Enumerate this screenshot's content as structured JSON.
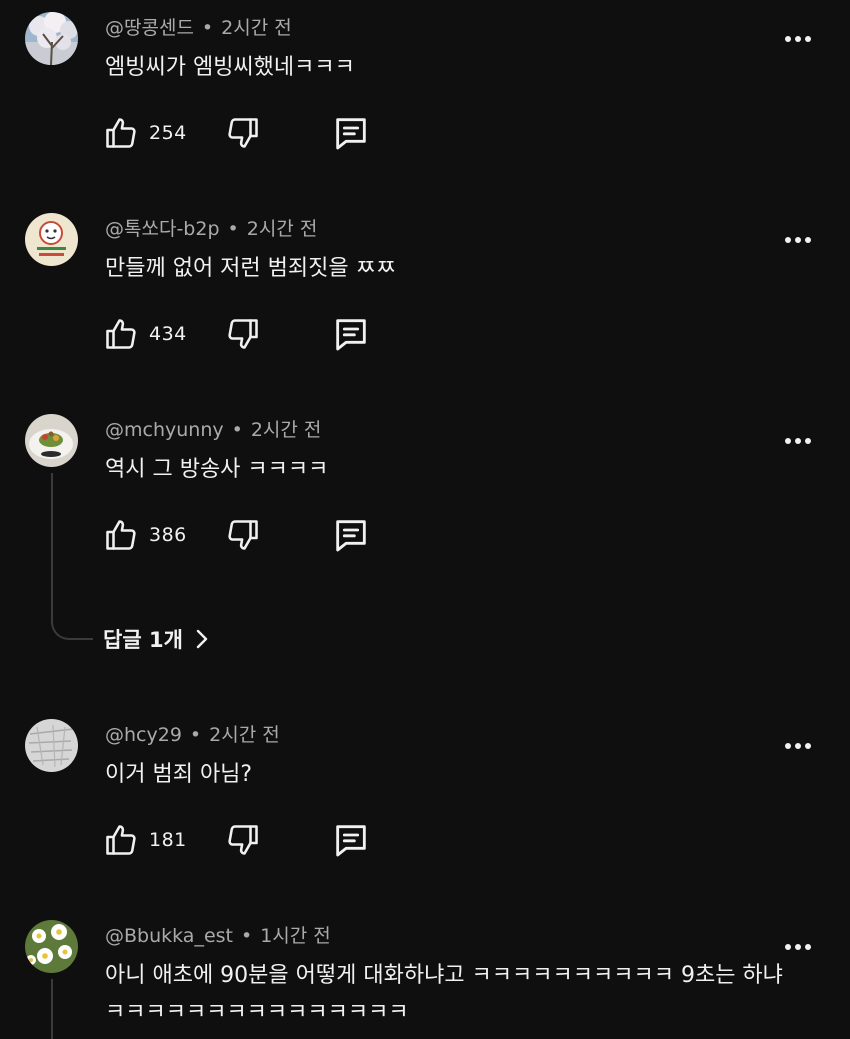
{
  "comments": [
    {
      "username": "@땅콩센드",
      "time": "2시간 전",
      "text": "엠빙씨가 엠빙씨했네ㅋㅋㅋ",
      "likes": "254",
      "avatar": "blossom-tree"
    },
    {
      "username": "@톡쏘다-b2p",
      "time": "2시간 전",
      "text": "만들께 없어 저런 범죄짓을 ㅉㅉ",
      "likes": "434",
      "avatar": "cartoon-sticker"
    },
    {
      "username": "@mchyunny",
      "time": "2시간 전",
      "text": "역시 그 방송사 ㅋㅋㅋㅋ",
      "likes": "386",
      "avatar": "food-plate",
      "replies_label": "답글 1개"
    },
    {
      "username": "@hcy29",
      "time": "2시간 전",
      "text": "이거 범죄 아님?",
      "likes": "181",
      "avatar": "gray-sketch"
    },
    {
      "username": "@Bbukka_est",
      "time": "1시간 전",
      "text": "아니 애초에 90분을 어떻게 대화하냐고 ㅋㅋㅋㅋㅋㅋㅋㅋㅋㅋ 9초는 하냐 ㅋㅋㅋㅋㅋㅋㅋㅋㅋㅋㅋㅋㅋㅋㅋ",
      "likes": "",
      "avatar": "daisies"
    }
  ],
  "separator": "•",
  "icons": {
    "like": "thumbs-up-icon",
    "dislike": "thumbs-down-icon",
    "reply": "comment-icon",
    "more": "more-vert-icon",
    "chevron": "chevron-right-icon"
  },
  "colors": {
    "background": "#0f0f0f",
    "text": "#f1f1f1",
    "meta": "#aaaaaa",
    "thread": "#3a3a3a"
  }
}
